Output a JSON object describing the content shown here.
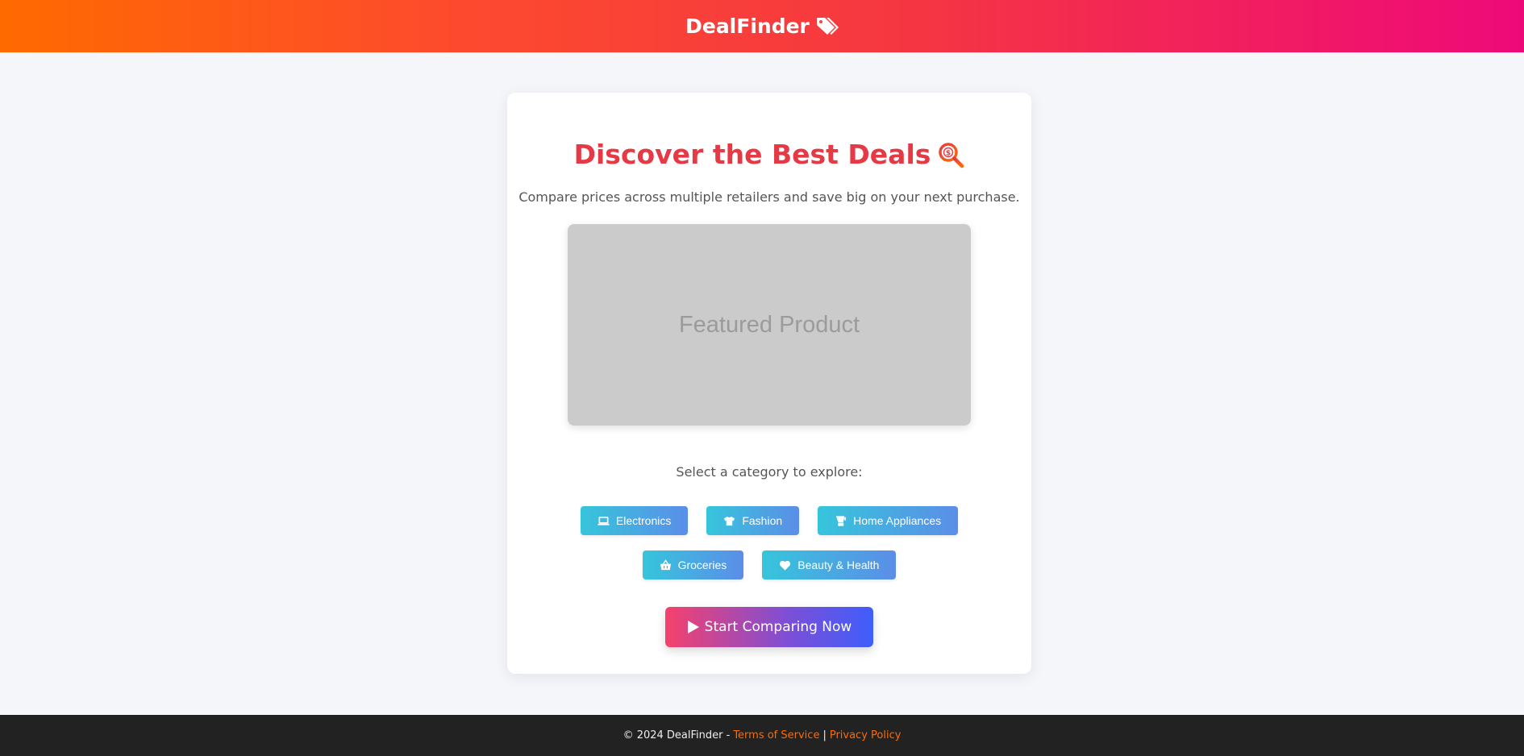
{
  "header": {
    "brand": "DealFinder",
    "brand_icon": "tags-icon"
  },
  "hero": {
    "title": "Discover the Best Deals",
    "title_icon": "search-dollar-icon",
    "subtitle": "Compare prices across multiple retailers and save big on your next purchase.",
    "featured_label": "Featured Product"
  },
  "categories": {
    "prompt": "Select a category to explore:",
    "items": [
      {
        "label": "Electronics",
        "icon": "laptop-icon"
      },
      {
        "label": "Fashion",
        "icon": "tshirt-icon"
      },
      {
        "label": "Home Appliances",
        "icon": "blender-icon"
      },
      {
        "label": "Groceries",
        "icon": "basket-icon"
      },
      {
        "label": "Beauty & Health",
        "icon": "heart-icon"
      }
    ]
  },
  "cta": {
    "label": "Start Comparing Now",
    "icon": "play-icon"
  },
  "footer": {
    "copyright": "© 2024 DealFinder -",
    "terms": "Terms of Service",
    "separator": "|",
    "privacy": "Privacy Policy"
  },
  "colors": {
    "accent": "#e63946",
    "link": "#ff6a00",
    "footer_bg": "#222222",
    "page_bg": "#f5f6fa"
  }
}
